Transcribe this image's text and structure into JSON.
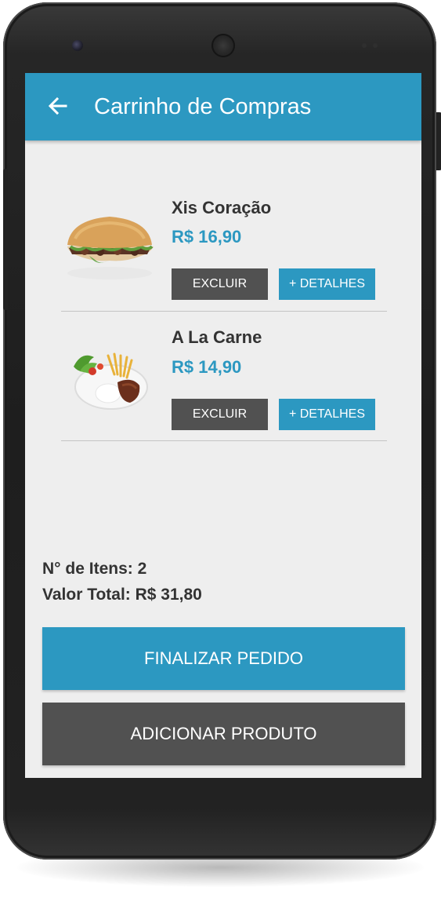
{
  "app_bar": {
    "title": "Carrinho de Compras",
    "back_icon": "arrow-left-icon",
    "color": "#2c98c1"
  },
  "cart": {
    "items": [
      {
        "name": "Xis Coração",
        "price": "R$ 16,90",
        "image": "burger-image",
        "remove_label": "EXCLUIR",
        "details_label": "+ DETALHES"
      },
      {
        "name": "A La Carne",
        "price": "R$ 14,90",
        "image": "meat-plate-image",
        "remove_label": "EXCLUIR",
        "details_label": "+ DETALHES"
      }
    ]
  },
  "summary": {
    "items_count_label": "N° de Itens: 2",
    "total_label": "Valor Total:  R$ 31,80"
  },
  "actions": {
    "checkout_label": "FINALIZAR PEDIDO",
    "add_product_label": "ADICIONAR PRODUTO"
  },
  "colors": {
    "accent": "#2c98c1",
    "dark_button": "#515151",
    "background": "#eeeeee",
    "text": "#333333"
  }
}
